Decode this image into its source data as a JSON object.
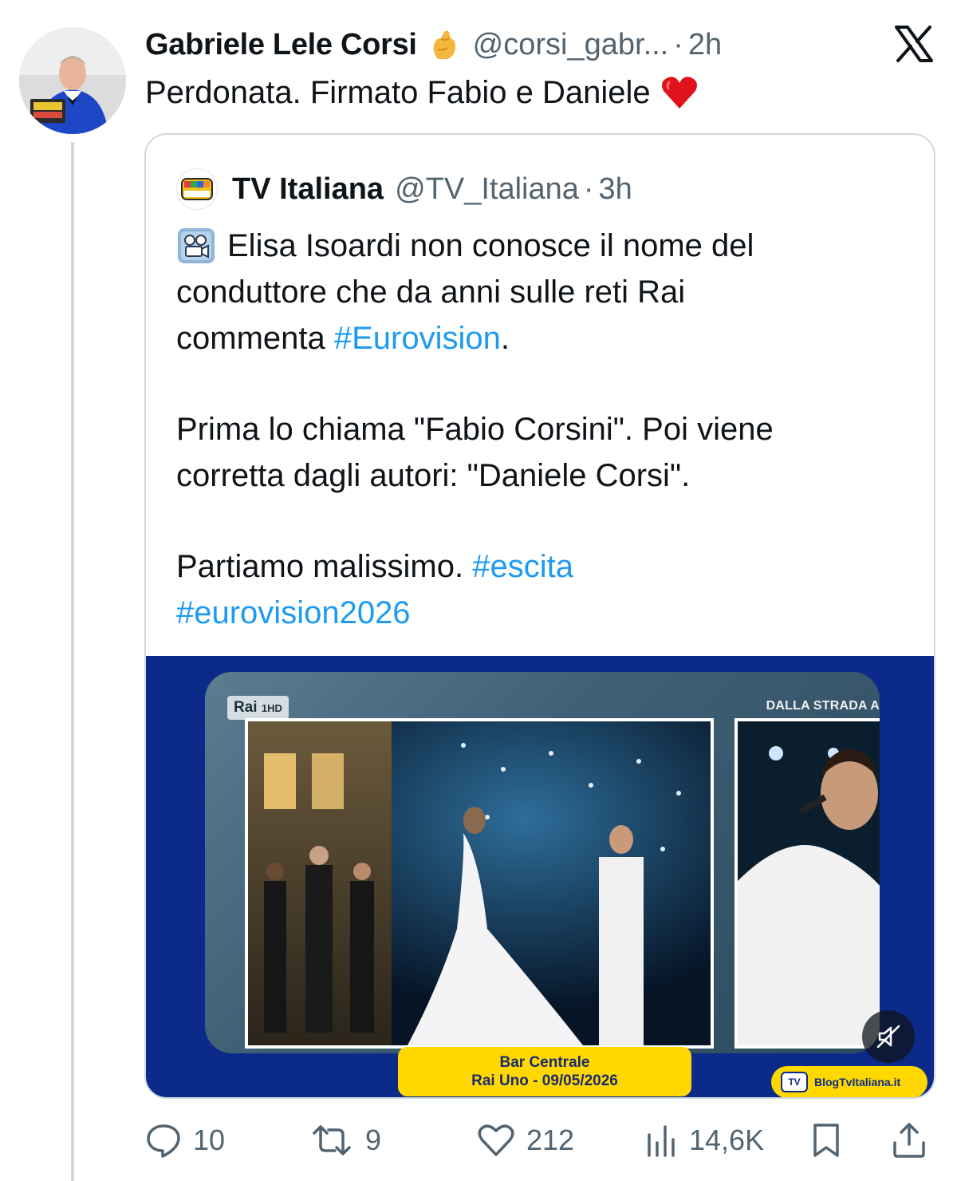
{
  "tweet": {
    "author_name": "Gabriele Lele Corsi",
    "author_emoji": "pinched-fingers-emoji",
    "author_handle": "@corsi_gabr...",
    "separator": "·",
    "time": "2h",
    "text": "Perdonata. Firmato Fabio e Daniele",
    "text_emoji": "red-heart-emoji"
  },
  "platform_logo": "x-logo",
  "quoted_tweet": {
    "author_name": "TV Italiana",
    "author_handle": "@TV_Italiana",
    "separator": "·",
    "time": "3h",
    "lead_emoji": "movie-camera-emoji",
    "line1": "Elisa Isoardi non conosce il nome del",
    "line2": "conduttore che da anni sulle reti Rai",
    "line3_prefix": "commenta ",
    "line3_hashtag": "#Eurovision",
    "line3_suffix": ".",
    "line4": "Prima lo chiama \"Fabio Corsini\". Poi viene",
    "line5": "corretta dagli autori: \"Daniele Corsi\".",
    "line6_prefix": "Partiamo malissimo. ",
    "line6_hashtag": "#escita",
    "line7_hashtag": "#eurovision2026",
    "media": {
      "channel_logo": "Rai",
      "channel_sub": "1HD",
      "strip_text": "DALLA STRADA A",
      "caption_line1": "Bar Centrale",
      "caption_line2": "Rai Uno - 09/05/2026",
      "badge_logo": "TV",
      "badge_text": "BlogTvItaliana.it",
      "mute_icon": "speaker-muted-icon"
    }
  },
  "actions": {
    "replies": "10",
    "reposts": "9",
    "likes": "212",
    "views": "14,6K"
  },
  "colors": {
    "text": "#0f1419",
    "secondary": "#536471",
    "link": "#1d9bf0",
    "border": "#cfd9de",
    "media_bg": "#0b2a8a",
    "caption_yellow": "#ffd800"
  }
}
